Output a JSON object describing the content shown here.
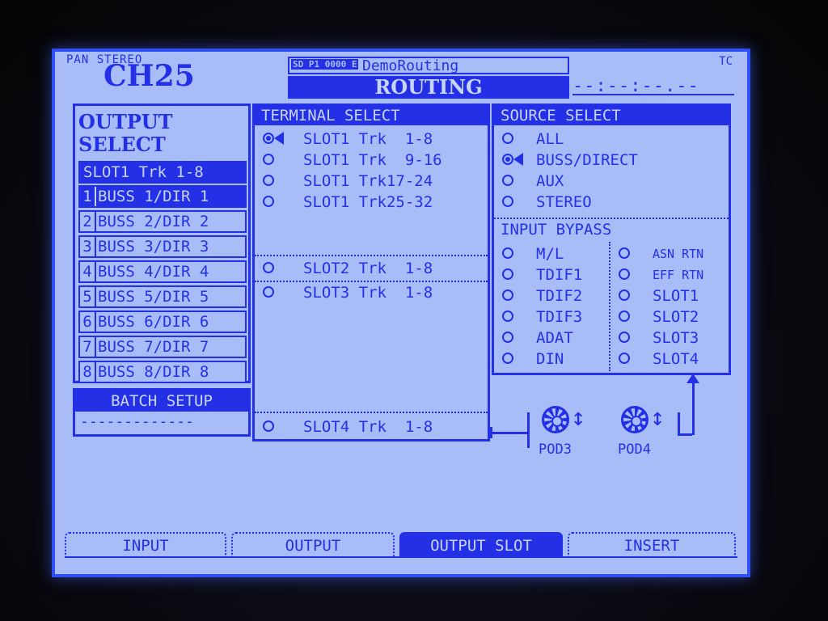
{
  "header": {
    "mode": "PAN STEREO",
    "channel": "CH25",
    "scene_icons": "SD P1 0000 E",
    "scene_name": "DemoRouting",
    "title": "ROUTING",
    "tc_label": "TC",
    "tc_value": "--:--:--.--"
  },
  "output_select": {
    "title_line1": "OUTPUT",
    "title_line2": "SELECT",
    "slot_header": "SLOT1 Trk 1-8",
    "rows": [
      {
        "num": "1",
        "label": "BUSS 1/DIR 1"
      },
      {
        "num": "2",
        "label": "BUSS 2/DIR 2"
      },
      {
        "num": "3",
        "label": "BUSS 3/DIR 3"
      },
      {
        "num": "4",
        "label": "BUSS 4/DIR 4"
      },
      {
        "num": "5",
        "label": "BUSS 5/DIR 5"
      },
      {
        "num": "6",
        "label": "BUSS 6/DIR 6"
      },
      {
        "num": "7",
        "label": "BUSS 7/DIR 7"
      },
      {
        "num": "8",
        "label": "BUSS 8/DIR 8"
      }
    ],
    "selected_index": 0
  },
  "batch_setup": {
    "label": "BATCH SETUP",
    "value": "-------------"
  },
  "terminal_select": {
    "title": "TERMINAL SELECT",
    "items": [
      {
        "label": "SLOT1 Trk  1-8",
        "selected": true
      },
      {
        "label": "SLOT1 Trk  9-16",
        "selected": false
      },
      {
        "label": "SLOT1 Trk17-24",
        "selected": false
      },
      {
        "label": "SLOT1 Trk25-32",
        "selected": false
      },
      {
        "label": "SLOT2 Trk  1-8",
        "selected": false
      },
      {
        "label": "SLOT3 Trk  1-8",
        "selected": false
      },
      {
        "label": "SLOT4 Trk  1-8",
        "selected": false
      }
    ]
  },
  "source_select": {
    "title": "SOURCE SELECT",
    "items": [
      {
        "label": "ALL",
        "selected": false
      },
      {
        "label": "BUSS/DIRECT",
        "selected": true
      },
      {
        "label": "AUX",
        "selected": false
      },
      {
        "label": "STEREO",
        "selected": false
      }
    ],
    "input_bypass_title": "INPUT BYPASS",
    "bypass_left": [
      "M/L",
      "TDIF1",
      "TDIF2",
      "TDIF3",
      "ADAT",
      "DIN"
    ],
    "bypass_right": [
      "ASN RTN",
      "EFF RTN",
      "SLOT1",
      "SLOT2",
      "SLOT3",
      "SLOT4"
    ]
  },
  "pods": [
    {
      "label": "POD3"
    },
    {
      "label": "POD4"
    }
  ],
  "tabs": [
    {
      "label": "INPUT",
      "active": false
    },
    {
      "label": "OUTPUT",
      "active": false
    },
    {
      "label": "OUTPUT SLOT",
      "active": true
    },
    {
      "label": "INSERT",
      "active": false
    }
  ],
  "colors": {
    "background": "#a8bdf7",
    "ink": "#2430e6",
    "bezel": "#08080d"
  }
}
